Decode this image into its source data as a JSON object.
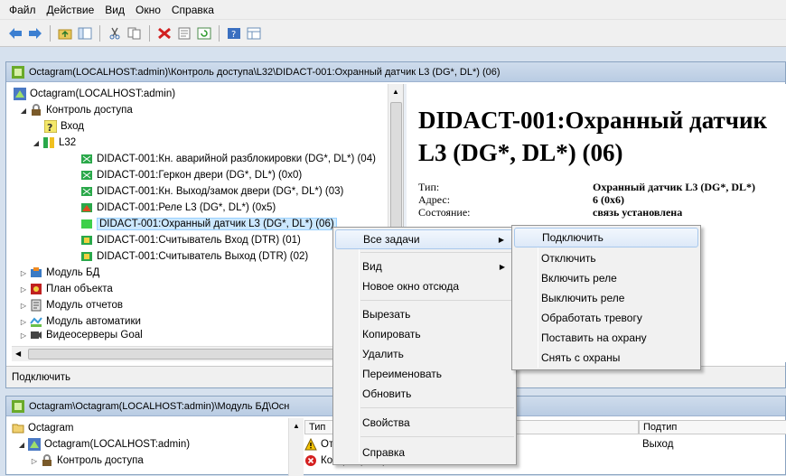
{
  "menubar": [
    "Файл",
    "Действие",
    "Вид",
    "Окно",
    "Справка"
  ],
  "icons": {
    "back": "back-arrow-icon",
    "forward": "forward-arrow-icon"
  },
  "window1": {
    "title": "Octagram(LOCALHOST:admin)\\Контроль доступа\\L32\\DIDACT-001:Охранный датчик L3 (DG*, DL*) (06)",
    "tree": [
      {
        "label": "Octagram(LOCALHOST:admin)"
      },
      {
        "label": "Контроль доступа"
      },
      {
        "label": "Вход"
      },
      {
        "label": "L32"
      },
      {
        "label": "DIDACT-001:Кн. аварийной разблокировки (DG*, DL*) (04)"
      },
      {
        "label": "DIDACT-001:Геркон двери (DG*, DL*) (0x0)"
      },
      {
        "label": "DIDACT-001:Кн. Выход/замок двери (DG*, DL*) (03)"
      },
      {
        "label": "DIDACT-001:Реле L3  (DG*, DL*) (0x5)"
      },
      {
        "label": "DIDACT-001:Охранный датчик L3 (DG*, DL*) (06)"
      },
      {
        "label": "DIDACT-001:Считыватель Вход (DTR) (01)"
      },
      {
        "label": "DIDACT-001:Считыватель Выход (DTR) (02)"
      },
      {
        "label": "Модуль БД"
      },
      {
        "label": "План объекта"
      },
      {
        "label": "Модуль отчетов"
      },
      {
        "label": "Модуль автоматики"
      },
      {
        "label": "Видеосерверы Goal"
      }
    ],
    "detail": {
      "heading_line1": "DIDACT-001:Охранный датчик",
      "heading_line2": "L3 (DG*, DL*) (06)",
      "props": [
        {
          "name": "Тип:",
          "value": "Охранный датчик L3 (DG*, DL*)"
        },
        {
          "name": "Адрес:",
          "value": "6 (0x6)"
        },
        {
          "name": "Состояние:",
          "value": "связь установлена"
        }
      ]
    },
    "status": "Подключить"
  },
  "window2": {
    "title": "Octagram\\Octagram(LOCALHOST:admin)\\Модуль БД\\Осн",
    "tree": [
      {
        "label": "Octagram"
      },
      {
        "label": "Octagram(LOCALHOST:admin)"
      },
      {
        "label": "Контроль доступа"
      }
    ],
    "columns": [
      "Тип",
      "Подтип"
    ],
    "rows": [
      {
        "type": "Отк",
        "subtype": "Выход"
      },
      {
        "type": "Концентратор не отвечает",
        "subtype": ""
      }
    ]
  },
  "context_menu": {
    "items": [
      "Все задачи",
      "Вид",
      "Новое окно отсюда",
      "Вырезать",
      "Копировать",
      "Удалить",
      "Переименовать",
      "Обновить",
      "Свойства",
      "Справка"
    ]
  },
  "submenu": {
    "items": [
      "Подключить",
      "Отключить",
      "Включить реле",
      "Выключить реле",
      "Обработать тревогу",
      "Поставить на охрану",
      "Снять с охраны"
    ]
  }
}
